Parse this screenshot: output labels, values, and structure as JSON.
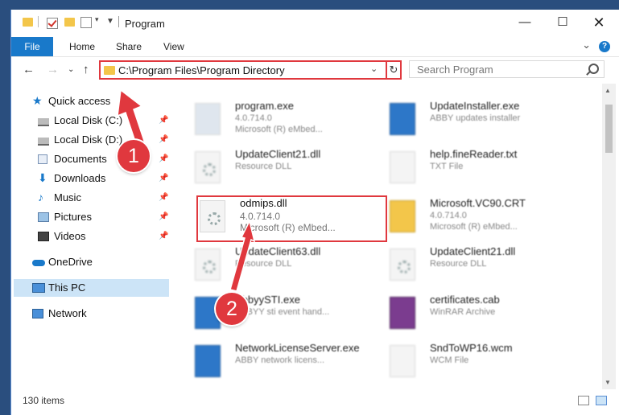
{
  "window": {
    "title": "Program"
  },
  "ribbon": {
    "tabs": [
      "File",
      "Home",
      "Share",
      "View"
    ]
  },
  "nav": {
    "address": "C:\\Program Files\\Program Directory",
    "search_placeholder": "Search Program"
  },
  "sidebar": {
    "items": [
      {
        "label": "Quick access",
        "icon": "star-icon",
        "pinned": false
      },
      {
        "label": "Local Disk (C:)",
        "icon": "drive-icon",
        "pinned": true
      },
      {
        "label": "Local Disk (D:)",
        "icon": "drive-icon",
        "pinned": true
      },
      {
        "label": "Documents",
        "icon": "documents-icon",
        "pinned": true
      },
      {
        "label": "Downloads",
        "icon": "downloads-icon",
        "pinned": true
      },
      {
        "label": "Music",
        "icon": "music-icon",
        "pinned": true
      },
      {
        "label": "Pictures",
        "icon": "pictures-icon",
        "pinned": true
      },
      {
        "label": "Videos",
        "icon": "videos-icon",
        "pinned": true
      },
      {
        "label": "OneDrive",
        "icon": "onedrive-icon",
        "pinned": false
      },
      {
        "label": "This PC",
        "icon": "pc-icon",
        "pinned": false,
        "selected": true
      },
      {
        "label": "Network",
        "icon": "network-icon",
        "pinned": false
      }
    ]
  },
  "files": [
    {
      "name": "program.exe",
      "line2": "4.0.714.0",
      "line3": "Microsoft (R) eMbed..."
    },
    {
      "name": "UpdateInstaller.exe",
      "line2": "ABBY updates installer",
      "line3": ""
    },
    {
      "name": "UpdateClient21.dll",
      "line2": "Resource DLL",
      "line3": ""
    },
    {
      "name": "help.fineReader.txt",
      "line2": "TXT File",
      "line3": ""
    },
    {
      "name": "odmips.dll",
      "line2": "4.0.714.0",
      "line3": "Microsoft (R) eMbed..."
    },
    {
      "name": "Microsoft.VC90.CRT",
      "line2": "4.0.714.0",
      "line3": "Microsoft (R) eMbed..."
    },
    {
      "name": "UpdateClient63.dll",
      "line2": "Resource DLL",
      "line3": ""
    },
    {
      "name": "UpdateClient21.dll",
      "line2": "Resource DLL",
      "line3": ""
    },
    {
      "name": "AbbyySTI.exe",
      "line2": "ABBYY sti event hand...",
      "line3": ""
    },
    {
      "name": "certificates.cab",
      "line2": "WinRAR Archive",
      "line3": ""
    },
    {
      "name": "NetworkLicenseServer.exe",
      "line2": "ABBY network licens...",
      "line3": ""
    },
    {
      "name": "SndToWP16.wcm",
      "line2": "WCM File",
      "line3": ""
    }
  ],
  "status": {
    "item_count": "130 items"
  },
  "callouts": [
    "1",
    "2"
  ],
  "colors": {
    "accent": "#1979ca",
    "callout": "#e0383e",
    "folder": "#f3c64a",
    "selected": "#cce4f7"
  }
}
